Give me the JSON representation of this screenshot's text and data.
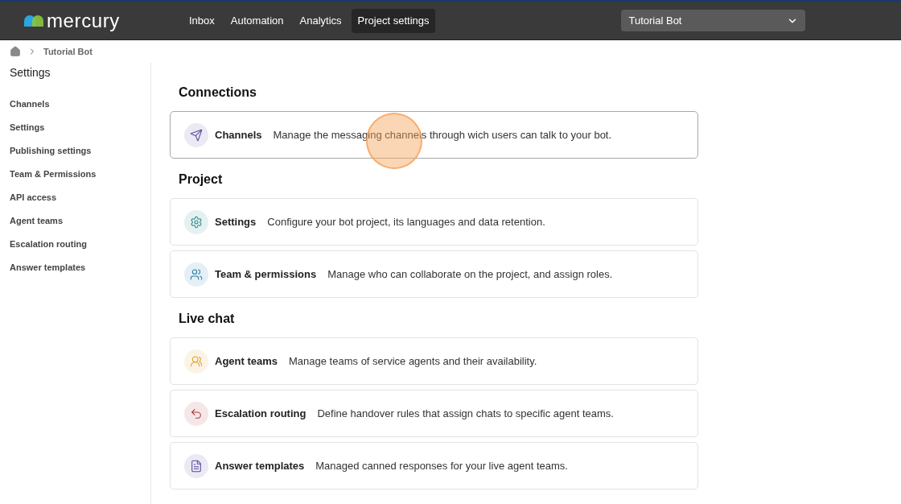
{
  "header": {
    "logo": "mercury",
    "nav": [
      {
        "label": "Inbox",
        "selected": false
      },
      {
        "label": "Automation",
        "selected": false
      },
      {
        "label": "Analytics",
        "selected": false
      },
      {
        "label": "Project settings",
        "selected": true
      }
    ],
    "project_select": {
      "value": "Tutorial Bot"
    }
  },
  "breadcrumb": [
    "Tutorial Bot"
  ],
  "sidebar": {
    "title": "Settings",
    "items": [
      {
        "label": "Channels"
      },
      {
        "label": "Settings"
      },
      {
        "label": "Publishing settings"
      },
      {
        "label": "Team & Permissions"
      },
      {
        "label": "API access"
      },
      {
        "label": "Agent teams"
      },
      {
        "label": "Escalation routing"
      },
      {
        "label": "Answer templates"
      }
    ]
  },
  "sections": [
    {
      "title": "Connections",
      "cards": [
        {
          "kind": "send",
          "title": "Channels",
          "description": "Manage the messaging channels through wich users can talk to your bot.",
          "selected": true
        }
      ]
    },
    {
      "title": "Project",
      "cards": [
        {
          "kind": "gear",
          "title": "Settings",
          "description": "Configure your bot project, its languages and data retention.",
          "selected": false
        },
        {
          "kind": "users",
          "title": "Team & permissions",
          "description": "Manage who can collaborate on the project, and assign roles.",
          "selected": false
        }
      ]
    },
    {
      "title": "Live chat",
      "cards": [
        {
          "kind": "group",
          "title": "Agent teams",
          "description": "Manage teams of service agents and their availability.",
          "selected": false
        },
        {
          "kind": "route",
          "title": "Escalation routing",
          "description": "Define handover rules that assign chats to specific agent teams.",
          "selected": false
        },
        {
          "kind": "document",
          "title": "Answer templates",
          "description": "Managed canned responses for your live agent teams.",
          "selected": false
        }
      ]
    }
  ]
}
